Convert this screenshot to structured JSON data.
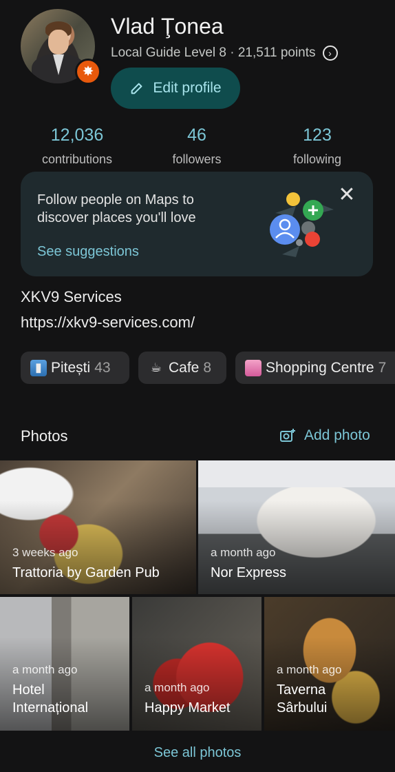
{
  "profile": {
    "name": "Vlad Ţonea",
    "level_text": "Local Guide Level 8 · 21,511 points",
    "edit_label": "Edit profile"
  },
  "stats": [
    {
      "value": "12,036",
      "label": "contributions"
    },
    {
      "value": "46",
      "label": "followers"
    },
    {
      "value": "123",
      "label": "following"
    }
  ],
  "suggestion_card": {
    "message": "Follow people on Maps to discover places you'll love",
    "link": "See suggestions"
  },
  "business": {
    "name": "XKV9 Services",
    "url": "https://xkv9-services.com/"
  },
  "chips": [
    {
      "label": "Pitești",
      "count": "43",
      "icon": "city-icon"
    },
    {
      "label": "Cafe",
      "count": "8",
      "icon": "coffee-icon"
    },
    {
      "label": "Shopping Centre",
      "count": "7",
      "icon": "shopping-bag-icon"
    }
  ],
  "photos": {
    "title": "Photos",
    "add_label": "Add photo",
    "see_all": "See all photos",
    "items": [
      {
        "ago": "3 weeks ago",
        "title": "Trattoria by Garden Pub"
      },
      {
        "ago": "a month ago",
        "title": "Nor Express"
      },
      {
        "ago": "a month ago",
        "title": "Hotel Internațional"
      },
      {
        "ago": "a month ago",
        "title": "Happy Market"
      },
      {
        "ago": "a month ago",
        "title": "Taverna Sârbului"
      }
    ]
  },
  "colors": {
    "accent": "#7cc6d6",
    "background": "#131314",
    "edit_button": "#0f4c4d",
    "badge": "#e8590c"
  }
}
